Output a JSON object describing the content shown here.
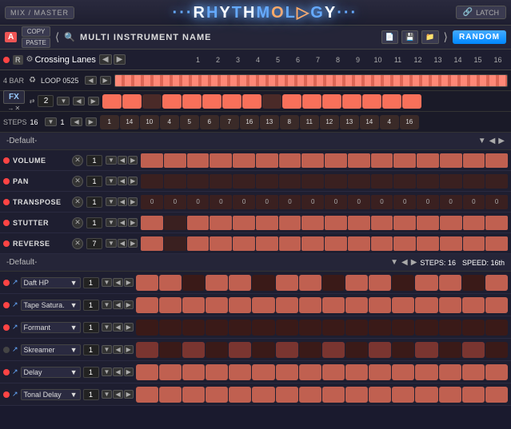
{
  "topbar": {
    "mix_master": "MIX / MASTER",
    "logo": "RHYTHMOLOGY",
    "latch": "LATCH"
  },
  "instrument_bar": {
    "a_badge": "A",
    "copy": "COPY",
    "paste": "PASTE",
    "instrument_name": "MULTI INSTRUMENT NAME",
    "random": "RANDOM"
  },
  "lane": {
    "r_label": "R",
    "crossing_lanes": "Crossing Lanes",
    "step_numbers": [
      "1",
      "2",
      "3",
      "4",
      "5",
      "6",
      "7",
      "8",
      "9",
      "10",
      "11",
      "12",
      "13",
      "14",
      "15",
      "16"
    ]
  },
  "loop": {
    "four_bar": "4 BAR",
    "loop_name": "LOOP 0525"
  },
  "fx_row": {
    "fx": "FX",
    "num": "2",
    "step_vals": [
      "on",
      "on",
      "off",
      "on",
      "on",
      "on",
      "on",
      "on",
      "off",
      "on",
      "on",
      "on",
      "on",
      "on",
      "on",
      "on"
    ]
  },
  "steps_row": {
    "steps_label": "STEPS",
    "steps_val": "16",
    "val2": "1",
    "numbers": [
      "1",
      "14",
      "10",
      "4",
      "5",
      "6",
      "7",
      "16",
      "13",
      "8",
      "11",
      "12",
      "13",
      "14",
      "4",
      "16"
    ]
  },
  "default_section": {
    "name": "-Default-"
  },
  "params": [
    {
      "name": "VOLUME",
      "led": "red",
      "val": "1",
      "cells": [
        "on",
        "on",
        "on",
        "on",
        "on",
        "on",
        "on",
        "on",
        "on",
        "on",
        "on",
        "on",
        "on",
        "on",
        "on",
        "on"
      ]
    },
    {
      "name": "PAN",
      "led": "red",
      "val": "1",
      "cells": [
        "off",
        "off",
        "off",
        "off",
        "off",
        "off",
        "off",
        "off",
        "off",
        "off",
        "off",
        "off",
        "off",
        "off",
        "off",
        "off"
      ]
    },
    {
      "name": "TRANSPOSE",
      "led": "red",
      "val": "1",
      "numbers": [
        "0",
        "0",
        "0",
        "0",
        "0",
        "0",
        "0",
        "0",
        "0",
        "0",
        "0",
        "0",
        "0",
        "0",
        "0",
        "0"
      ]
    },
    {
      "name": "STUTTER",
      "led": "red",
      "val": "1",
      "cells": [
        "on",
        "off",
        "on",
        "on",
        "on",
        "on",
        "on",
        "on",
        "on",
        "on",
        "on",
        "on",
        "on",
        "on",
        "on",
        "on"
      ]
    },
    {
      "name": "REVERSE",
      "led": "red",
      "val": "7",
      "cells": [
        "on",
        "off",
        "on",
        "on",
        "on",
        "on",
        "on",
        "on",
        "on",
        "on",
        "on",
        "on",
        "on",
        "on",
        "on",
        "on"
      ]
    }
  ],
  "bottom_section": {
    "name": "-Default-",
    "steps": "16",
    "speed": "16th"
  },
  "instruments": [
    {
      "name": "Daft HP",
      "led": "red",
      "val": "1",
      "cells": [
        "on",
        "on",
        "off",
        "on",
        "on",
        "off",
        "on",
        "on",
        "off",
        "on",
        "on",
        "off",
        "on",
        "on",
        "off",
        "on"
      ]
    },
    {
      "name": "Tape Satura.",
      "led": "red",
      "val": "1",
      "cells": [
        "on",
        "on",
        "on",
        "on",
        "on",
        "on",
        "on",
        "on",
        "on",
        "on",
        "on",
        "on",
        "on",
        "on",
        "on",
        "on"
      ]
    },
    {
      "name": "Formant",
      "led": "red",
      "val": "1",
      "cells": [
        "off",
        "off",
        "off",
        "off",
        "off",
        "off",
        "off",
        "off",
        "off",
        "off",
        "off",
        "off",
        "off",
        "off",
        "off",
        "off"
      ]
    },
    {
      "name": "Skreamer",
      "led": "off",
      "val": "1",
      "cells": [
        "on",
        "off",
        "on",
        "off",
        "on",
        "off",
        "on",
        "off",
        "on",
        "off",
        "on",
        "off",
        "on",
        "off",
        "on",
        "off"
      ]
    },
    {
      "name": "Delay",
      "led": "red",
      "val": "1",
      "cells": [
        "on",
        "on",
        "on",
        "on",
        "on",
        "on",
        "on",
        "on",
        "on",
        "on",
        "on",
        "on",
        "on",
        "on",
        "on",
        "on"
      ]
    },
    {
      "name": "Tonal Delay",
      "led": "red",
      "val": "1",
      "cells": [
        "on",
        "on",
        "on",
        "on",
        "on",
        "on",
        "on",
        "on",
        "on",
        "on",
        "on",
        "on",
        "on",
        "on",
        "on",
        "on"
      ]
    }
  ]
}
